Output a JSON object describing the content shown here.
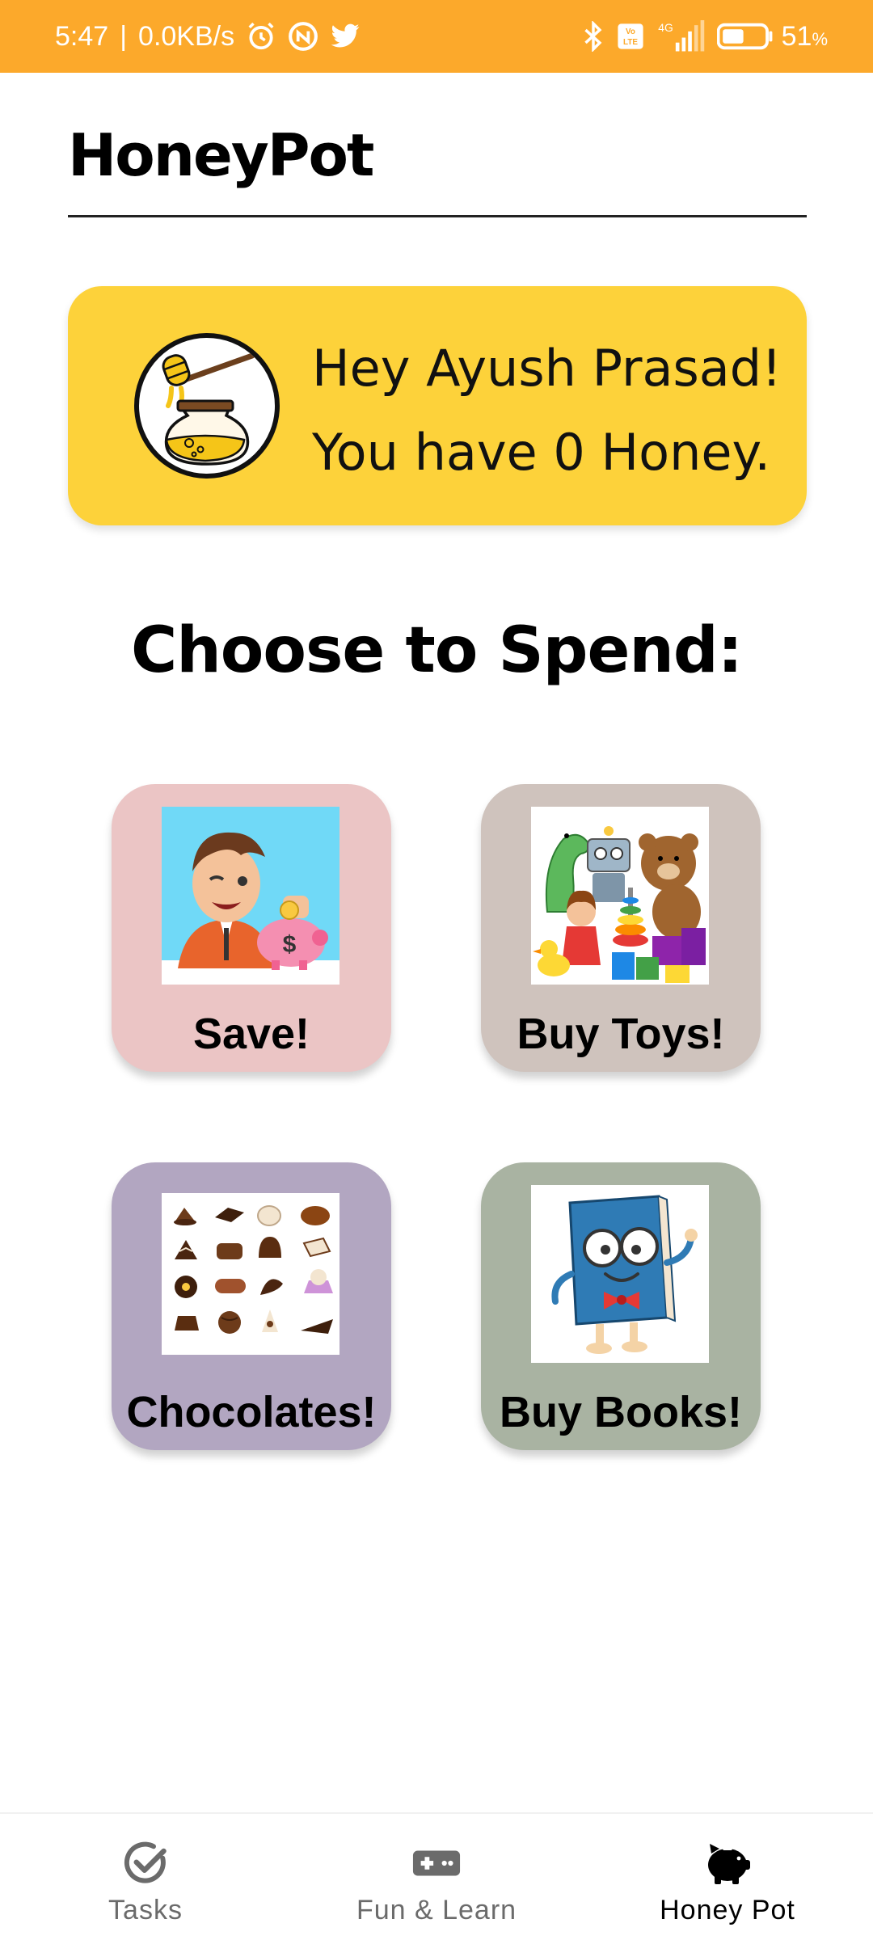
{
  "status_bar": {
    "time": "5:47",
    "separator": "|",
    "network_speed": "0.0KB/s",
    "battery_percent": "51",
    "battery_unit": "%",
    "network_type": "4G",
    "left_icons": [
      "alarm-icon",
      "app-notification-icon",
      "twitter-icon"
    ],
    "right_icons": [
      "bluetooth-icon",
      "volte-icon",
      "signal-icon",
      "battery-icon"
    ],
    "color": "#FCA92B"
  },
  "header": {
    "title": "HoneyPot"
  },
  "greeting": {
    "line1": "Hey Ayush Prasad!",
    "line2": "You have 0 Honey.",
    "icon": "honey-pot-icon",
    "color": "#FDD23A"
  },
  "section": {
    "title": "Choose to Spend:"
  },
  "options": [
    {
      "label": "Save!",
      "image": "boy-saving-piggy-bank",
      "color": "#EBC5C5"
    },
    {
      "label": "Buy Toys!",
      "image": "toy-pile",
      "color": "#CFC3BD"
    },
    {
      "label": "Chocolates!",
      "image": "assorted-chocolates",
      "color": "#B2A6C1"
    },
    {
      "label": "Buy Books!",
      "image": "cartoon-book-character",
      "color": "#A9B3A2"
    }
  ],
  "bottom_nav": {
    "items": [
      {
        "label": "Tasks",
        "icon": "check-circle-icon",
        "active": false
      },
      {
        "label": "Fun & Learn",
        "icon": "gamepad-icon",
        "active": false
      },
      {
        "label": "Honey Pot",
        "icon": "piggy-bank-icon",
        "active": true
      }
    ]
  }
}
